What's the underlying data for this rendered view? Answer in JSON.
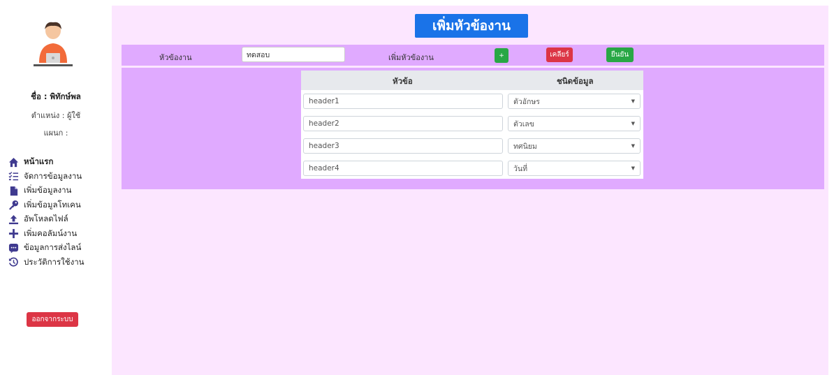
{
  "sidebar": {
    "name": "ชื่อ : พิทักษ์พล",
    "position": "ตำแหน่ง : ผู้ใช้",
    "department": "แผนก :",
    "items": [
      {
        "label": "หน้าแรก",
        "icon": "home-icon"
      },
      {
        "label": "จัดการข้อมูลงาน",
        "icon": "list-check-icon"
      },
      {
        "label": "เพิ่มข้อมูลงาน",
        "icon": "file-icon"
      },
      {
        "label": "เพิ่มข้อมูลโทเคน",
        "icon": "key-icon"
      },
      {
        "label": "อัพโหลดไฟล์",
        "icon": "upload-icon"
      },
      {
        "label": "เพิ่มคอลัมน์งาน",
        "icon": "plus-icon"
      },
      {
        "label": "ข้อมูลการส่งไลน์",
        "icon": "chat-icon"
      },
      {
        "label": "ประวัติการใช้งาน",
        "icon": "history-icon"
      }
    ],
    "logout_label": "ออกจากระบบ"
  },
  "main": {
    "title": "เพิ่มหัวข้องาน",
    "toolbar": {
      "topic_label": "หัวข้องาน",
      "topic_value": "ทดสอบ",
      "add_header_label": "เพิ่มหัวข้องาน",
      "add_button": "+",
      "clear_button": "เคลียร์",
      "confirm_button": "ยืนยัน"
    },
    "table": {
      "columns": [
        "หัวข้อ",
        "ชนิดข้อมูล"
      ],
      "rows": [
        {
          "header": "header1",
          "type": "ตัวอักษร"
        },
        {
          "header": "header2",
          "type": "ตัวเลข"
        },
        {
          "header": "header3",
          "type": "ทศนิยม"
        },
        {
          "header": "header4",
          "type": "วันที่"
        }
      ]
    }
  },
  "colors": {
    "main_bg": "#fce6ff",
    "panel_bg": "#e0aaff",
    "title_bg": "#1a73e8",
    "danger": "#dc3545",
    "success": "#28a745",
    "icon": "#3f3a8f"
  }
}
